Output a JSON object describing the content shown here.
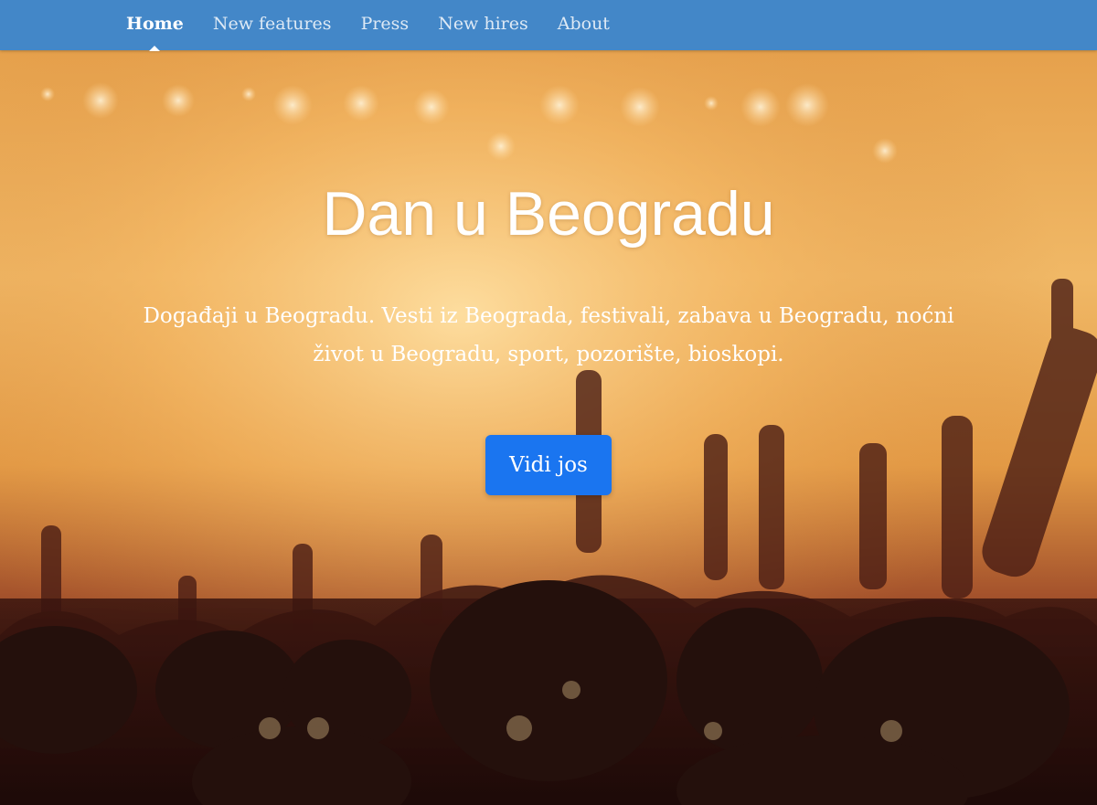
{
  "navbar": {
    "items": [
      {
        "label": "Home",
        "active": true
      },
      {
        "label": "New features",
        "active": false
      },
      {
        "label": "Press",
        "active": false
      },
      {
        "label": "New hires",
        "active": false
      },
      {
        "label": "About",
        "active": false
      }
    ]
  },
  "hero": {
    "title": "Dan u Beogradu",
    "subtitle": "Događaji u Beogradu. Vesti iz Beograda, festivali, zabava u Beogradu, noćni život u Beogradu, sport, pozorište, bioskopi.",
    "button_label": "Vidi jos",
    "background_image": "concert-crowd-photo"
  },
  "colors": {
    "navbar": "#4387c8",
    "button": "#1a75f0",
    "hero_warm": "#f0b866",
    "hero_dark": "#2a0f0c"
  }
}
